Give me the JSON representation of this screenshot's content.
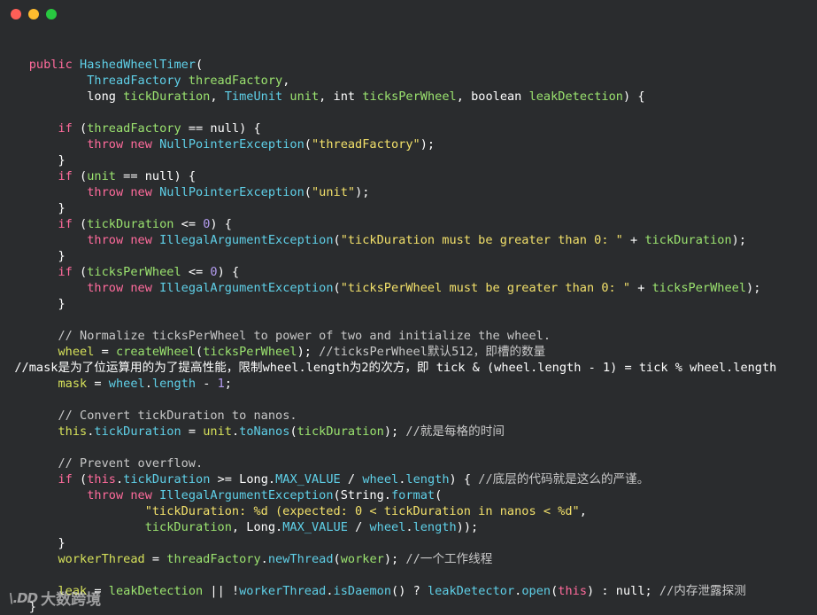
{
  "window": {
    "traffic_lights": [
      {
        "name": "close",
        "color": "#ff5f57"
      },
      {
        "name": "minimize",
        "color": "#febc2e"
      },
      {
        "name": "maximize",
        "color": "#28c840"
      }
    ]
  },
  "code_lines": [
    [
      {
        "t": "    ",
        "c": ""
      }
    ],
    [
      {
        "t": "    ",
        "c": ""
      },
      {
        "t": "public",
        "c": "k"
      },
      {
        "t": " ",
        "c": ""
      },
      {
        "t": "HashedWheelTimer",
        "c": "t"
      },
      {
        "t": "(",
        "c": "o"
      }
    ],
    [
      {
        "t": "            ",
        "c": ""
      },
      {
        "t": "ThreadFactory",
        "c": "t"
      },
      {
        "t": " ",
        "c": ""
      },
      {
        "t": "threadFactory",
        "c": "p"
      },
      {
        "t": ",",
        "c": "o"
      }
    ],
    [
      {
        "t": "            ",
        "c": ""
      },
      {
        "t": "long",
        "c": "n"
      },
      {
        "t": " ",
        "c": ""
      },
      {
        "t": "tickDuration",
        "c": "p"
      },
      {
        "t": ", ",
        "c": "o"
      },
      {
        "t": "TimeUnit",
        "c": "t"
      },
      {
        "t": " ",
        "c": ""
      },
      {
        "t": "unit",
        "c": "p"
      },
      {
        "t": ", ",
        "c": "o"
      },
      {
        "t": "int",
        "c": "n"
      },
      {
        "t": " ",
        "c": ""
      },
      {
        "t": "ticksPerWheel",
        "c": "p"
      },
      {
        "t": ", ",
        "c": "o"
      },
      {
        "t": "boolean",
        "c": "n"
      },
      {
        "t": " ",
        "c": ""
      },
      {
        "t": "leakDetection",
        "c": "p"
      },
      {
        "t": ") {",
        "c": "o"
      }
    ],
    [
      {
        "t": "",
        "c": ""
      }
    ],
    [
      {
        "t": "        ",
        "c": ""
      },
      {
        "t": "if",
        "c": "k"
      },
      {
        "t": " (",
        "c": "o"
      },
      {
        "t": "threadFactory",
        "c": "p"
      },
      {
        "t": " == ",
        "c": "o"
      },
      {
        "t": "null",
        "c": "n"
      },
      {
        "t": ") {",
        "c": "o"
      }
    ],
    [
      {
        "t": "            ",
        "c": ""
      },
      {
        "t": "throw",
        "c": "k"
      },
      {
        "t": " ",
        "c": ""
      },
      {
        "t": "new",
        "c": "k"
      },
      {
        "t": " ",
        "c": ""
      },
      {
        "t": "NullPointerException",
        "c": "t"
      },
      {
        "t": "(",
        "c": "o"
      },
      {
        "t": "\"threadFactory\"",
        "c": "s"
      },
      {
        "t": ");",
        "c": "o"
      }
    ],
    [
      {
        "t": "        }",
        "c": "o"
      }
    ],
    [
      {
        "t": "        ",
        "c": ""
      },
      {
        "t": "if",
        "c": "k"
      },
      {
        "t": " (",
        "c": "o"
      },
      {
        "t": "unit",
        "c": "p"
      },
      {
        "t": " == ",
        "c": "o"
      },
      {
        "t": "null",
        "c": "n"
      },
      {
        "t": ") {",
        "c": "o"
      }
    ],
    [
      {
        "t": "            ",
        "c": ""
      },
      {
        "t": "throw",
        "c": "k"
      },
      {
        "t": " ",
        "c": ""
      },
      {
        "t": "new",
        "c": "k"
      },
      {
        "t": " ",
        "c": ""
      },
      {
        "t": "NullPointerException",
        "c": "t"
      },
      {
        "t": "(",
        "c": "o"
      },
      {
        "t": "\"unit\"",
        "c": "s"
      },
      {
        "t": ");",
        "c": "o"
      }
    ],
    [
      {
        "t": "        }",
        "c": "o"
      }
    ],
    [
      {
        "t": "        ",
        "c": ""
      },
      {
        "t": "if",
        "c": "k"
      },
      {
        "t": " (",
        "c": "o"
      },
      {
        "t": "tickDuration",
        "c": "p"
      },
      {
        "t": " <= ",
        "c": "o"
      },
      {
        "t": "0",
        "c": "num"
      },
      {
        "t": ") {",
        "c": "o"
      }
    ],
    [
      {
        "t": "            ",
        "c": ""
      },
      {
        "t": "throw",
        "c": "k"
      },
      {
        "t": " ",
        "c": ""
      },
      {
        "t": "new",
        "c": "k"
      },
      {
        "t": " ",
        "c": ""
      },
      {
        "t": "IllegalArgumentException",
        "c": "t"
      },
      {
        "t": "(",
        "c": "o"
      },
      {
        "t": "\"tickDuration must be greater than 0: \"",
        "c": "s"
      },
      {
        "t": " + ",
        "c": "o"
      },
      {
        "t": "tickDuration",
        "c": "p"
      },
      {
        "t": ");",
        "c": "o"
      }
    ],
    [
      {
        "t": "        }",
        "c": "o"
      }
    ],
    [
      {
        "t": "        ",
        "c": ""
      },
      {
        "t": "if",
        "c": "k"
      },
      {
        "t": " (",
        "c": "o"
      },
      {
        "t": "ticksPerWheel",
        "c": "p"
      },
      {
        "t": " <= ",
        "c": "o"
      },
      {
        "t": "0",
        "c": "num"
      },
      {
        "t": ") {",
        "c": "o"
      }
    ],
    [
      {
        "t": "            ",
        "c": ""
      },
      {
        "t": "throw",
        "c": "k"
      },
      {
        "t": " ",
        "c": ""
      },
      {
        "t": "new",
        "c": "k"
      },
      {
        "t": " ",
        "c": ""
      },
      {
        "t": "IllegalArgumentException",
        "c": "t"
      },
      {
        "t": "(",
        "c": "o"
      },
      {
        "t": "\"ticksPerWheel must be greater than 0: \"",
        "c": "s"
      },
      {
        "t": " + ",
        "c": "o"
      },
      {
        "t": "ticksPerWheel",
        "c": "p"
      },
      {
        "t": ");",
        "c": "o"
      }
    ],
    [
      {
        "t": "        }",
        "c": "o"
      }
    ],
    [
      {
        "t": "",
        "c": ""
      }
    ],
    [
      {
        "t": "        ",
        "c": ""
      },
      {
        "t": "// Normalize ticksPerWheel to power of two and initialize the wheel.",
        "c": "c"
      }
    ],
    [
      {
        "t": "        ",
        "c": ""
      },
      {
        "t": "wheel",
        "c": "f"
      },
      {
        "t": " = ",
        "c": "o"
      },
      {
        "t": "createWheel",
        "c": "p"
      },
      {
        "t": "(",
        "c": "o"
      },
      {
        "t": "ticksPerWheel",
        "c": "p"
      },
      {
        "t": "); ",
        "c": "o"
      },
      {
        "t": "//ticksPerWheel默认512，即槽的数量",
        "c": "c"
      }
    ],
    [
      {
        "t": "  //mask是为了位运算用的为了提高性能，限制wheel.length为2的次方，即 tick & (wheel.length - 1) = tick % wheel.length",
        "c": "o"
      }
    ],
    [
      {
        "t": "        ",
        "c": ""
      },
      {
        "t": "mask",
        "c": "f"
      },
      {
        "t": " = ",
        "c": "o"
      },
      {
        "t": "wheel",
        "c": "t"
      },
      {
        "t": ".",
        "c": "o"
      },
      {
        "t": "length",
        "c": "t"
      },
      {
        "t": " - ",
        "c": "o"
      },
      {
        "t": "1",
        "c": "num"
      },
      {
        "t": ";",
        "c": "o"
      }
    ],
    [
      {
        "t": "",
        "c": ""
      }
    ],
    [
      {
        "t": "        ",
        "c": ""
      },
      {
        "t": "// Convert tickDuration to nanos.",
        "c": "c"
      }
    ],
    [
      {
        "t": "        ",
        "c": ""
      },
      {
        "t": "this",
        "c": "f"
      },
      {
        "t": ".",
        "c": "o"
      },
      {
        "t": "tickDuration",
        "c": "t"
      },
      {
        "t": " = ",
        "c": "o"
      },
      {
        "t": "unit",
        "c": "f"
      },
      {
        "t": ".",
        "c": "o"
      },
      {
        "t": "toNanos",
        "c": "t"
      },
      {
        "t": "(",
        "c": "o"
      },
      {
        "t": "tickDuration",
        "c": "p"
      },
      {
        "t": "); ",
        "c": "o"
      },
      {
        "t": "//就是每格的时间",
        "c": "c"
      }
    ],
    [
      {
        "t": "",
        "c": ""
      }
    ],
    [
      {
        "t": "        ",
        "c": ""
      },
      {
        "t": "// Prevent overflow.",
        "c": "c"
      }
    ],
    [
      {
        "t": "        ",
        "c": ""
      },
      {
        "t": "if",
        "c": "k"
      },
      {
        "t": " (",
        "c": "o"
      },
      {
        "t": "this",
        "c": "k"
      },
      {
        "t": ".",
        "c": "o"
      },
      {
        "t": "tickDuration",
        "c": "t"
      },
      {
        "t": " >= ",
        "c": "o"
      },
      {
        "t": "Long",
        "c": "n"
      },
      {
        "t": ".",
        "c": "o"
      },
      {
        "t": "MAX_VALUE",
        "c": "t"
      },
      {
        "t": " / ",
        "c": "o"
      },
      {
        "t": "wheel",
        "c": "t"
      },
      {
        "t": ".",
        "c": "o"
      },
      {
        "t": "length",
        "c": "t"
      },
      {
        "t": ") { ",
        "c": "o"
      },
      {
        "t": "//底层的代码就是这么的严谨。",
        "c": "c"
      }
    ],
    [
      {
        "t": "            ",
        "c": ""
      },
      {
        "t": "throw",
        "c": "k"
      },
      {
        "t": " ",
        "c": ""
      },
      {
        "t": "new",
        "c": "k"
      },
      {
        "t": " ",
        "c": ""
      },
      {
        "t": "IllegalArgumentException",
        "c": "t"
      },
      {
        "t": "(",
        "c": "o"
      },
      {
        "t": "String",
        "c": "n"
      },
      {
        "t": ".",
        "c": "o"
      },
      {
        "t": "format",
        "c": "t"
      },
      {
        "t": "(",
        "c": "o"
      }
    ],
    [
      {
        "t": "                    ",
        "c": ""
      },
      {
        "t": "\"tickDuration: %d (expected: 0 < tickDuration in nanos < %d\"",
        "c": "s"
      },
      {
        "t": ",",
        "c": "o"
      }
    ],
    [
      {
        "t": "                    ",
        "c": ""
      },
      {
        "t": "tickDuration",
        "c": "p"
      },
      {
        "t": ", ",
        "c": "o"
      },
      {
        "t": "Long",
        "c": "n"
      },
      {
        "t": ".",
        "c": "o"
      },
      {
        "t": "MAX_VALUE",
        "c": "t"
      },
      {
        "t": " / ",
        "c": "o"
      },
      {
        "t": "wheel",
        "c": "t"
      },
      {
        "t": ".",
        "c": "o"
      },
      {
        "t": "length",
        "c": "t"
      },
      {
        "t": "));",
        "c": "o"
      }
    ],
    [
      {
        "t": "        }",
        "c": "o"
      }
    ],
    [
      {
        "t": "        ",
        "c": ""
      },
      {
        "t": "workerThread",
        "c": "f"
      },
      {
        "t": " = ",
        "c": "o"
      },
      {
        "t": "threadFactory",
        "c": "p"
      },
      {
        "t": ".",
        "c": "o"
      },
      {
        "t": "newThread",
        "c": "t"
      },
      {
        "t": "(",
        "c": "o"
      },
      {
        "t": "worker",
        "c": "p"
      },
      {
        "t": "); ",
        "c": "o"
      },
      {
        "t": "//一个工作线程",
        "c": "c"
      }
    ],
    [
      {
        "t": "",
        "c": ""
      }
    ],
    [
      {
        "t": "        ",
        "c": ""
      },
      {
        "t": "leak",
        "c": "f"
      },
      {
        "t": " = ",
        "c": "o"
      },
      {
        "t": "leakDetection",
        "c": "p"
      },
      {
        "t": " || !",
        "c": "o"
      },
      {
        "t": "workerThread",
        "c": "t"
      },
      {
        "t": ".",
        "c": "o"
      },
      {
        "t": "isDaemon",
        "c": "t"
      },
      {
        "t": "() ? ",
        "c": "o"
      },
      {
        "t": "leakDetector",
        "c": "t"
      },
      {
        "t": ".",
        "c": "o"
      },
      {
        "t": "open",
        "c": "t"
      },
      {
        "t": "(",
        "c": "o"
      },
      {
        "t": "this",
        "c": "k"
      },
      {
        "t": ") : ",
        "c": "o"
      },
      {
        "t": "null",
        "c": "n"
      },
      {
        "t": "; ",
        "c": "o"
      },
      {
        "t": "//内存泄露探测",
        "c": "c"
      }
    ],
    [
      {
        "t": "    }",
        "c": "o"
      }
    ]
  ],
  "watermark": {
    "logo": "\\.DD",
    "text": "大数跨境"
  }
}
